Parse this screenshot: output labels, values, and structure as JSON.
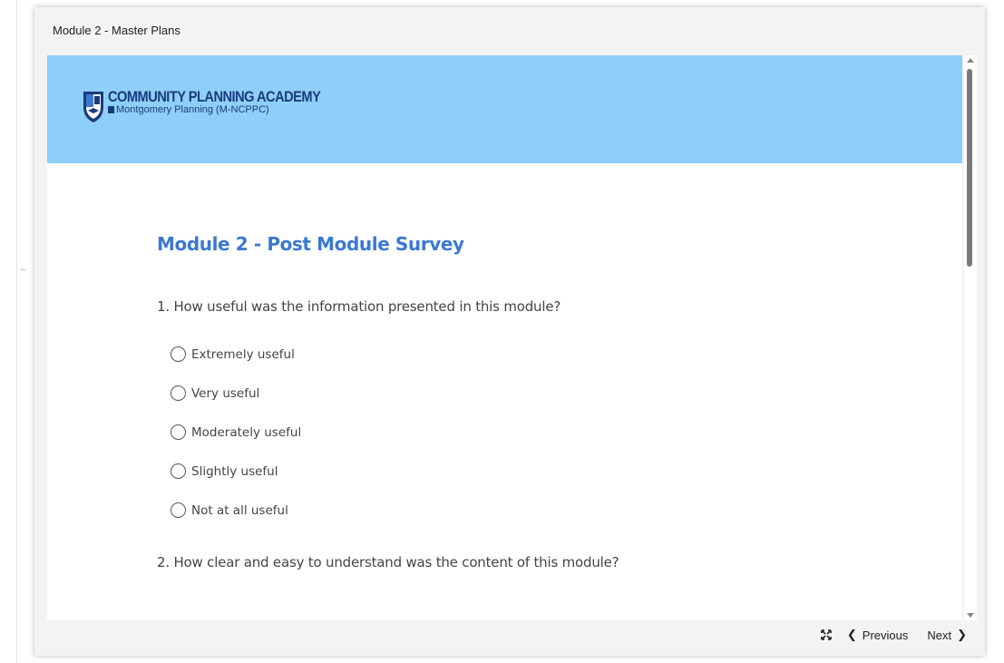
{
  "window": {
    "title": "Module 2 - Master Plans"
  },
  "banner": {
    "logo_line1": "COMMUNITY PLANNING ACADEMY",
    "logo_line2": "Montgomery Planning (M-NCPPC)",
    "background_color": "#8ecffa"
  },
  "survey": {
    "title": "Module 2 - Post Module Survey",
    "questions": [
      {
        "text": "1. How useful was the information presented in this module?",
        "options": [
          "Extremely useful",
          "Very useful",
          "Moderately useful",
          "Slightly useful",
          "Not at all useful"
        ]
      },
      {
        "text": "2. How clear and easy to understand was the content of this module?"
      }
    ]
  },
  "footer": {
    "expand_icon": "expand-icon",
    "previous_label": "Previous",
    "next_label": "Next"
  },
  "colors": {
    "accent": "#3b78d0",
    "logo_navy": "#1a3b7a"
  }
}
